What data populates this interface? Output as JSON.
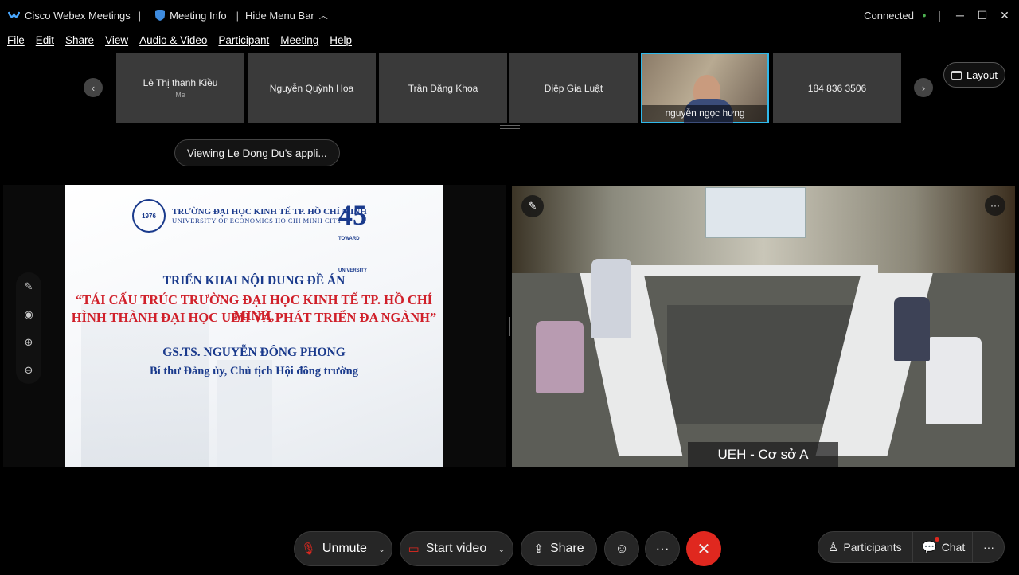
{
  "titlebar": {
    "app_name": "Cisco Webex Meetings",
    "meeting_info": "Meeting Info",
    "hide_menu": "Hide Menu Bar",
    "status": "Connected",
    "separator": "|"
  },
  "menu": [
    "File",
    "Edit",
    "Share",
    "View",
    "Audio & Video",
    "Participant",
    "Meeting",
    "Help"
  ],
  "filmstrip": {
    "tiles": [
      {
        "name": "Lê Thị thanh Kiều",
        "sub": "Me"
      },
      {
        "name": "Nguyễn Quỳnh Hoa"
      },
      {
        "name": "Trần Đăng Khoa"
      },
      {
        "name": "Diệp Gia Luật"
      },
      {
        "name": "nguyễn ngọc hưng",
        "active": true
      },
      {
        "name": "184 836 3506"
      }
    ],
    "layout_label": "Layout"
  },
  "viewing_label": "Viewing Le Dong Du's appli...",
  "slide": {
    "university_vi": "TRƯỜNG ĐẠI HỌC KINH TẾ TP. HỒ CHÍ MINH",
    "university_en": "UNIVERSITY OF ECONOMICS HO CHI MINH CITY",
    "seal_year": "1976",
    "anniversary": "45",
    "anniversary_sub": "TOWARD UNIVERSITY",
    "line1": "TRIỂN KHAI NỘI DUNG ĐỀ ÁN",
    "line2": "“TÁI CẤU TRÚC TRƯỜNG ĐẠI HỌC KINH TẾ TP. HỒ CHÍ MINH,",
    "line3": "HÌNH THÀNH ĐẠI HỌC UEH VÀ PHÁT TRIỂN ĐA NGÀNH”",
    "line4": "GS.TS. NGUYỄN ĐÔNG PHONG",
    "line5": "Bí thư Đảng ủy, Chủ tịch Hội đồng trường"
  },
  "room": {
    "label": "UEH - Cơ sở A"
  },
  "controls": {
    "unmute": "Unmute",
    "start_video": "Start video",
    "share": "Share",
    "participants": "Participants",
    "chat": "Chat"
  },
  "colors": {
    "accent": "#30b8ea",
    "end_red": "#e0281f",
    "slide_blue": "#1a3a8c",
    "slide_red": "#d0202a",
    "connected_green": "#4caf50"
  }
}
